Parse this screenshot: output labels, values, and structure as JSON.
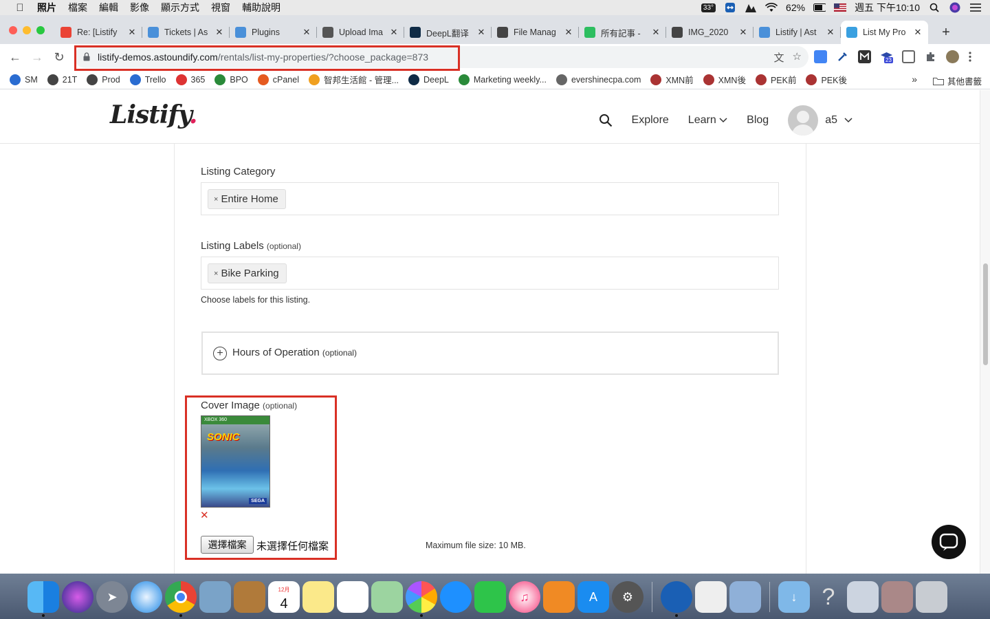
{
  "menubar": {
    "items": [
      "照片",
      "檔案",
      "編輯",
      "影像",
      "顯示方式",
      "視窗",
      "輔助說明"
    ],
    "temperature": "33°",
    "battery": "62%",
    "clock": "週五 下午10:10"
  },
  "tabs": [
    {
      "title": "Re: [Listify",
      "color": "#ea4335"
    },
    {
      "title": "Tickets | As",
      "color": "#4a90d9"
    },
    {
      "title": "Plugins",
      "color": "#4a90d9"
    },
    {
      "title": "Upload Ima",
      "color": "#555555"
    },
    {
      "title": "DeepL翻译",
      "color": "#0f2b46"
    },
    {
      "title": "File Manag",
      "color": "#444444"
    },
    {
      "title": "所有記事 -",
      "color": "#2dbe60"
    },
    {
      "title": "IMG_2020",
      "color": "#444444"
    },
    {
      "title": "Listify | Ast",
      "color": "#4a90d9"
    },
    {
      "title": "List My Pro",
      "color": "#3aa0e0"
    }
  ],
  "toolbar": {
    "url_host": "listify-demos.astoundify.com",
    "url_path": "/rentals/list-my-properties/?choose_package=873",
    "ext_badge": "23"
  },
  "bookmarks": [
    "SM",
    "21T",
    "Prod",
    "Trello",
    "365",
    "BPO",
    "cPanel",
    "智邦生活館 - 管理...",
    "DeepL",
    "Marketing weekly...",
    "evershinecpa.com",
    "XMN前",
    "XMN後",
    "PEK前",
    "PEK後"
  ],
  "bookmarks_more": "»",
  "bookmarks_other": "其他書籤",
  "site": {
    "logo_text": "Listify",
    "logo_dot": ".",
    "nav_explore": "Explore",
    "nav_learn": "Learn",
    "nav_blog": "Blog",
    "username": "a5"
  },
  "form": {
    "category_label": "Listing Category",
    "category_value": "Entire Home",
    "labels_label": "Listing Labels",
    "optional": "(optional)",
    "labels_value": "Bike Parking",
    "labels_help": "Choose labels for this listing.",
    "hours_label": "Hours of Operation",
    "cover_label": "Cover Image",
    "cover_remove": "✕",
    "file_button": "選擇檔案",
    "file_none": "未選擇任何檔案",
    "max_size": "Maximum file size: 10 MB."
  },
  "cover_art": {
    "band_text": "XBOX 360",
    "title_text": "SONIC",
    "brand_text": "SEGA"
  },
  "dock": {
    "calendar_day": "4",
    "calendar_month": "12月"
  }
}
